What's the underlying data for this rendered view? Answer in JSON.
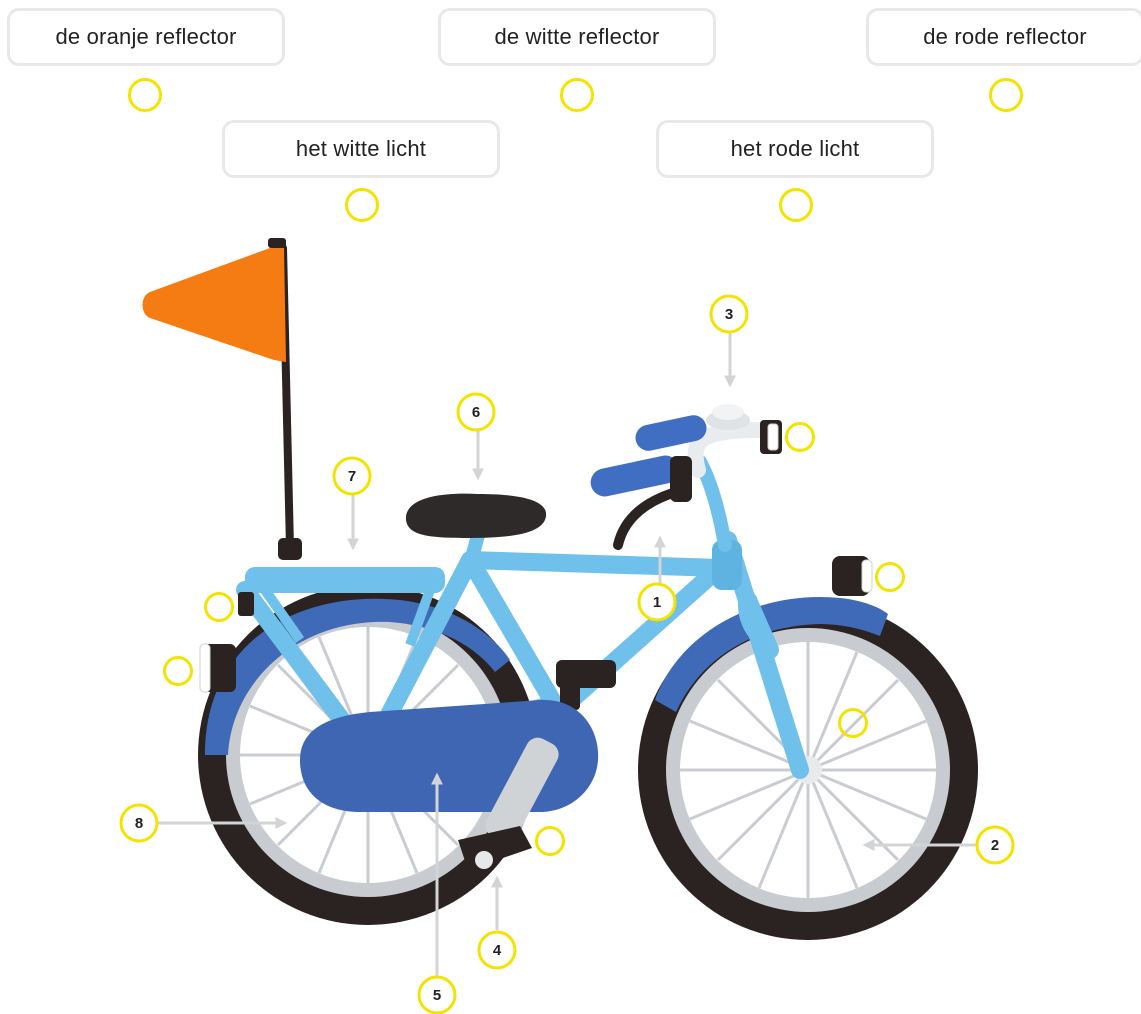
{
  "labels": [
    {
      "text": "de oranje reflector"
    },
    {
      "text": "de witte reflector"
    },
    {
      "text": "de rode reflector"
    },
    {
      "text": "het witte licht"
    },
    {
      "text": "het rode licht"
    }
  ],
  "callouts": [
    "1",
    "2",
    "3",
    "4",
    "5",
    "6",
    "7",
    "8"
  ],
  "colors": {
    "target_ring": "#f4e200",
    "frame": "#6fc0ea",
    "mudguard": "#3f6ab7",
    "chainguard": "#3f66b3",
    "tire": "#2b2321",
    "rim": "#c8ccd0",
    "saddle": "#2e2a29",
    "flag": "#f57c12",
    "grip": "#3f6ec2",
    "arrow": "#d2d4d6",
    "label_border": "#e8e8e8"
  }
}
